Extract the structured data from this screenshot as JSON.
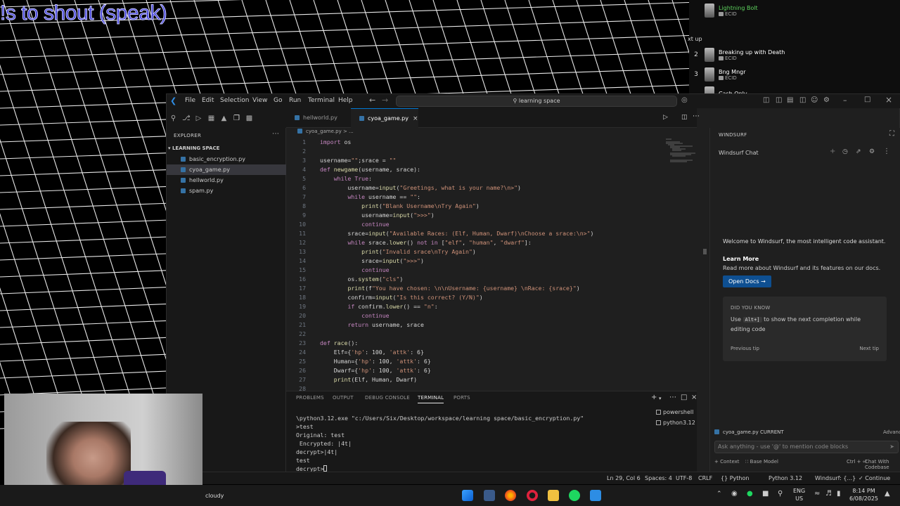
{
  "stream_overlay": {
    "title_text": "!s to shout (speak)",
    "up_next_label": "xt up"
  },
  "playlist": [
    {
      "num": "",
      "title": "Lightning Bolt",
      "artist": "ECID"
    },
    {
      "num": "2",
      "title": "Breaking up with Death",
      "artist": "ECID"
    },
    {
      "num": "3",
      "title": "Bng Mngr",
      "artist": "ECID"
    },
    {
      "num": "",
      "title": "Cash Only",
      "artist": ""
    }
  ],
  "titlebar": {
    "menus": [
      "File",
      "Edit",
      "Selection",
      "View",
      "Go",
      "Run",
      "Terminal",
      "Help"
    ],
    "search": "learning space"
  },
  "explorer": {
    "title": "EXPLORER",
    "folder": "LEARNING SPACE",
    "files": [
      "basic_encryption.py",
      "cyoa_game.py",
      "hellworld.py",
      "spam.py"
    ],
    "active_index": 1
  },
  "tabs": [
    {
      "label": "hellworld.py",
      "active": false
    },
    {
      "label": "cyoa_game.py",
      "active": true
    }
  ],
  "breadcrumb": "cyoa_game.py  > ...",
  "code": {
    "line_numbers": [
      "1",
      "2",
      "3",
      "4",
      "5",
      "6",
      "7",
      "8",
      "9",
      "10",
      "11",
      "12",
      "13",
      "14",
      "15",
      "16",
      "17",
      "18",
      "19",
      "20",
      "21",
      "22",
      "23",
      "24",
      "25",
      "26",
      "27",
      "28"
    ],
    "lines": [
      "import os",
      "",
      "username=\"\";srace = \"\"",
      "def newgame(username, srace):",
      "    while True:",
      "        username=input(\"Greetings, what is your name?\\n>\")",
      "        while username == \"\":",
      "            print(\"Blank Username\\nTry Again\")",
      "            username=input(\">>>\")",
      "            continue",
      "        srace=input(\"Available Races: (Elf, Human, Dwarf)\\nChoose a srace:\\n>\")",
      "        while srace.lower() not in [\"elf\", \"human\", \"dwarf\"]:",
      "            print(\"Invalid srace\\nTry Again\")",
      "            srace=input(\">>>\")",
      "            continue",
      "        os.system(\"cls\")",
      "        print(f\"You have chosen: \\n\\nUsername: {username} \\nRace: {srace}\")",
      "        confirm=input(\"Is this correct? (Y/N)\")",
      "        if confirm.lower() == \"n\":",
      "            continue",
      "        return username, srace",
      "",
      "def race():",
      "    Elf={'hp': 100, 'attk': 6}",
      "    Human={'hp': 100, 'attk': 6}",
      "    Dwarf={'hp': 100, 'attk': 6}",
      "    print(Elf, Human, Dwarf)",
      ""
    ]
  },
  "panel": {
    "tabs": [
      "PROBLEMS",
      "OUTPUT",
      "DEBUG CONSOLE",
      "TERMINAL",
      "PORTS"
    ],
    "active_tab": "TERMINAL",
    "terminal_lines": [
      "\\python3.12.exe \"c:/Users/Six/Desktop/workspace/learning space/basic_encryption.py\"",
      ">test",
      "Original: test",
      " Encrypted: |4t|",
      "decrypt>|4t|",
      "test",
      "decrypt>"
    ],
    "terminals": [
      "powershell",
      "python3.12"
    ]
  },
  "windsurf": {
    "title": "WINDSURF",
    "chat_label": "Windsurf Chat",
    "welcome": "Welcome to Windsurf, the most intelligent code assistant.",
    "learn_more": "Learn More",
    "learn_more_sub": "Read more about Windsurf and its features on our docs.",
    "open_docs": "Open Docs →",
    "tip_heading": "DID YOU KNOW",
    "tip_use": "Use",
    "tip_key": "Alt+]",
    "tip_rest": "to show the next completion while editing code",
    "previous_tip": "Previous tip",
    "next_tip": "Next tip",
    "file_chip": "cyoa_game.py  CURRENT",
    "advanced": "Advanced",
    "input_placeholder": "Ask anything - use '@' to mention code blocks",
    "context": "+ Context",
    "base_model": "∷ Base Model",
    "shortcut": "Ctrl + ⏎",
    "chat_codebase": "Chat With Codebase"
  },
  "statusbar": {
    "position": "Ln 29, Col 6",
    "spaces": "Spaces: 4",
    "encoding": "UTF-8",
    "eol": "CRLF",
    "language": "{} Python",
    "python_version": "Python 3.12",
    "windsurf": "Windsurf: {...}",
    "continue": "✓ Continue"
  },
  "taskbar": {
    "weather": "cloudy",
    "lang_top": "ENG",
    "lang_bottom": "US",
    "time": "8:14 PM",
    "date": "6/08/2025"
  }
}
